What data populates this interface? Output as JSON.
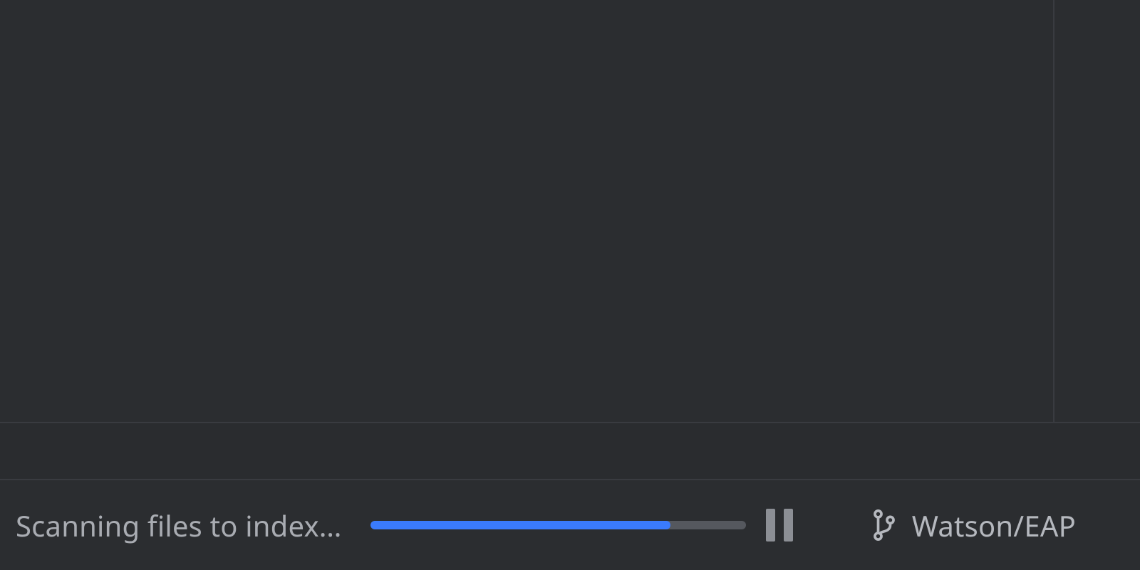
{
  "status": {
    "task_label": "Scanning files to index…",
    "progress_percent": 80,
    "pause_icon": "pause-icon",
    "branch_icon": "git-branch-icon",
    "branch_name": "Watson/EAP"
  },
  "colors": {
    "bg": "#2b2d30",
    "border": "#393b40",
    "text": "#a9acb2",
    "progress_track": "#55585e",
    "progress_fill": "#3a7bfd"
  }
}
